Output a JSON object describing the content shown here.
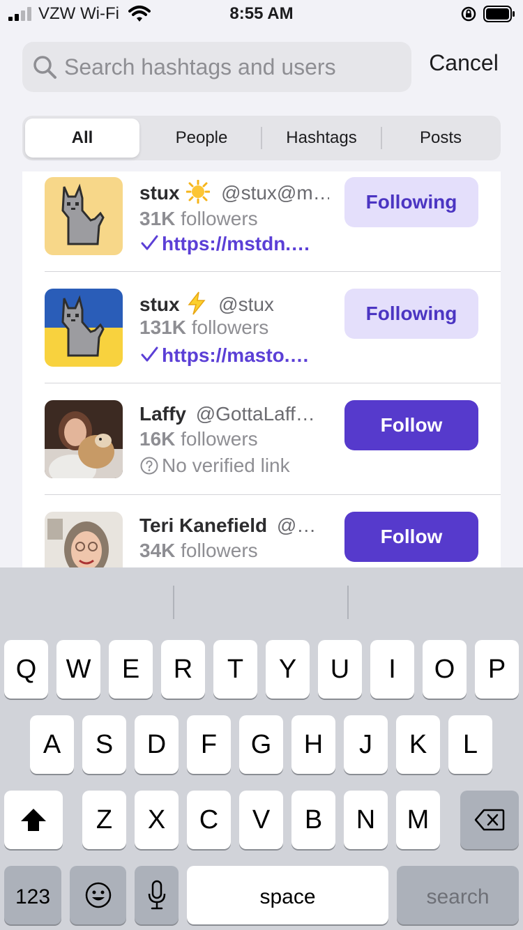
{
  "status_bar": {
    "carrier": "VZW Wi-Fi",
    "time": "8:55 AM"
  },
  "search": {
    "placeholder": "Search hashtags and users",
    "value": "",
    "cancel_label": "Cancel"
  },
  "tabs": [
    {
      "label": "All",
      "active": true
    },
    {
      "label": "People",
      "active": false
    },
    {
      "label": "Hashtags",
      "active": false
    },
    {
      "label": "Posts",
      "active": false
    }
  ],
  "results": [
    {
      "display_name": "stux",
      "emoji": "sun-icon",
      "handle": "@stux@m…",
      "followers_count": "31K",
      "followers_label": "followers",
      "link": "https://mstdn.…",
      "link_verified": true,
      "button_label": "Following",
      "avatar": "pixel-cat-yellow"
    },
    {
      "display_name": "stux",
      "emoji": "lightning-icon",
      "handle": "@stux",
      "followers_count": "131K",
      "followers_label": "followers",
      "link": "https://masto.…",
      "link_verified": true,
      "button_label": "Following",
      "avatar": "pixel-cat-ukraine"
    },
    {
      "display_name": "Laffy",
      "handle": "@GottaLaff…",
      "followers_count": "16K",
      "followers_label": "followers",
      "link": "No verified link",
      "link_verified": false,
      "button_label": "Follow",
      "avatar": "photo-woman-with-dog"
    },
    {
      "display_name": "Teri Kanefield",
      "handle": "@…",
      "followers_count": "34K",
      "followers_label": "followers",
      "button_label": "Follow",
      "avatar": "photo-woman-glasses"
    }
  ],
  "keyboard": {
    "row1": [
      "Q",
      "W",
      "E",
      "R",
      "T",
      "Y",
      "U",
      "I",
      "O",
      "P"
    ],
    "row2": [
      "A",
      "S",
      "D",
      "F",
      "G",
      "H",
      "J",
      "K",
      "L"
    ],
    "row3": [
      "Z",
      "X",
      "C",
      "V",
      "B",
      "N",
      "M"
    ],
    "numbers_label": "123",
    "space_label": "space",
    "search_label": "search"
  },
  "colors": {
    "accent": "#563acc",
    "following_bg": "#e4dffb",
    "verified_link": "#5b3fd6"
  }
}
